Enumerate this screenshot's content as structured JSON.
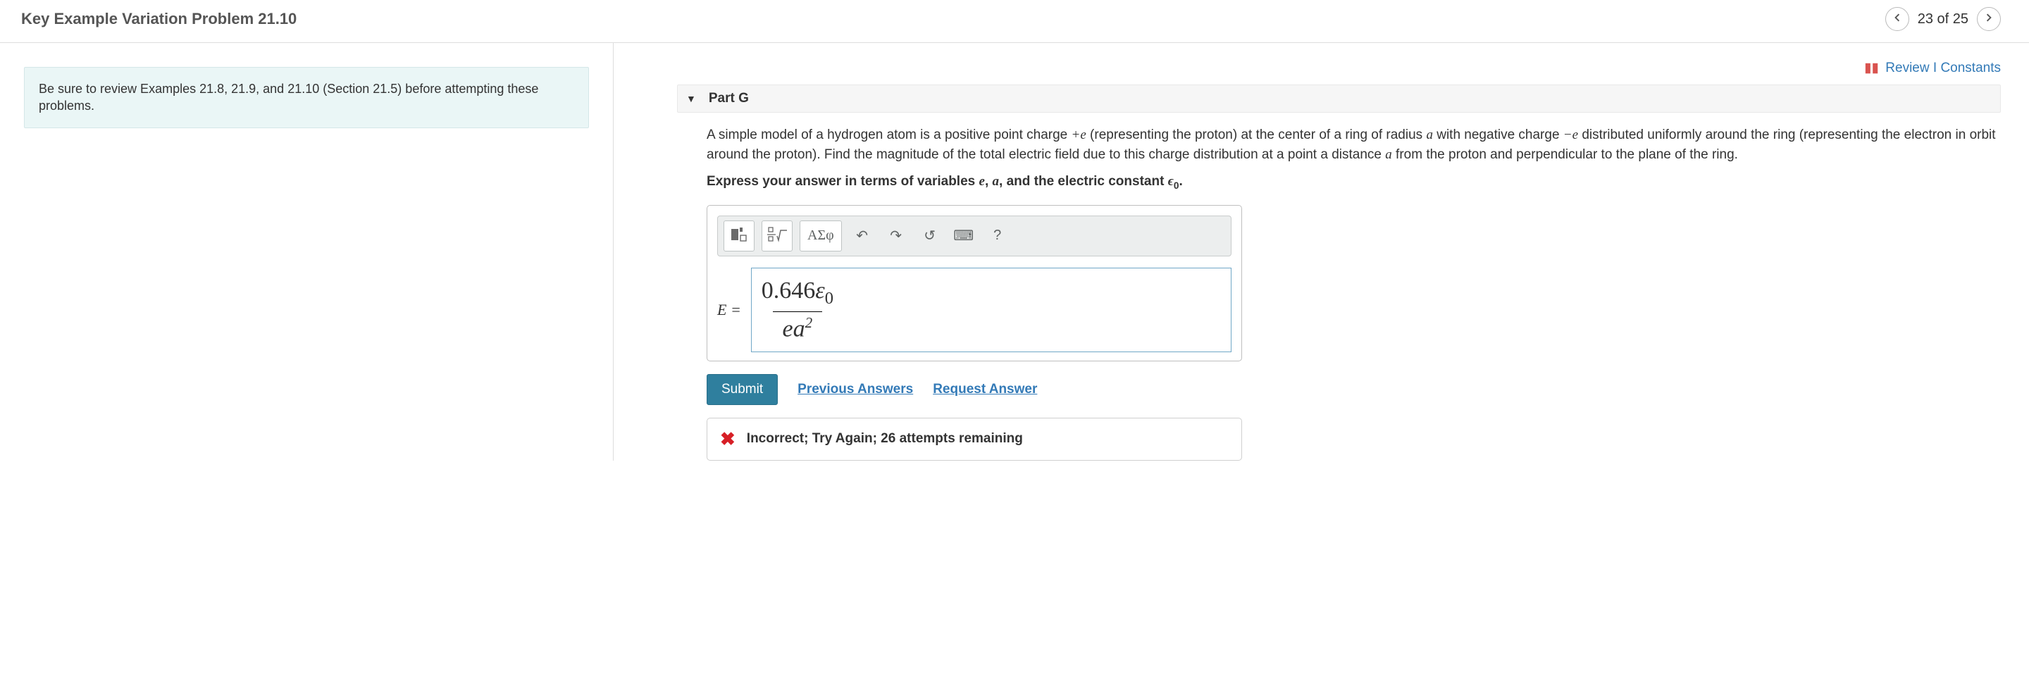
{
  "header": {
    "title": "Key Example Variation Problem 21.10",
    "position": "23 of 25"
  },
  "left": {
    "hint": "Be sure to review Examples 21.8, 21.9, and 21.10 (Section 21.5) before attempting these problems."
  },
  "resources": {
    "review": "Review",
    "constants": "Constants"
  },
  "part": {
    "label": "Part G",
    "problem_pre": "A simple model of a hydrogen atom is a positive point charge ",
    "problem_mid1": " (representing the proton) at the center of a ring of radius ",
    "problem_mid2": " with negative charge ",
    "problem_mid3": " distributed uniformly around the ring (representing the electron in orbit around the proton). Find the magnitude of the total electric field due to this charge distribution at a point a distance ",
    "problem_post": " from the proton and perpendicular to the plane of the ring.",
    "instr_pre": "Express your answer in terms of variables ",
    "instr_mid": ", and the electric constant ",
    "instr_post": ".",
    "sym_plus_e": "+e",
    "sym_a": "a",
    "sym_minus_e": "−e",
    "sym_e": "e",
    "sym_eps0_base": "ϵ",
    "sym_eps0_sub": "0",
    "toolbar": {
      "templates": "■",
      "greek": "ΑΣφ",
      "help": "?"
    },
    "answer": {
      "lhs": "E =",
      "numerator_coeff": "0.646",
      "numerator_var": "ε",
      "numerator_sub": "0",
      "denom_pre": "ea",
      "denom_sup": "2"
    },
    "actions": {
      "submit": "Submit",
      "previous": "Previous Answers",
      "request": "Request Answer"
    },
    "feedback": "Incorrect; Try Again; 26 attempts remaining"
  }
}
